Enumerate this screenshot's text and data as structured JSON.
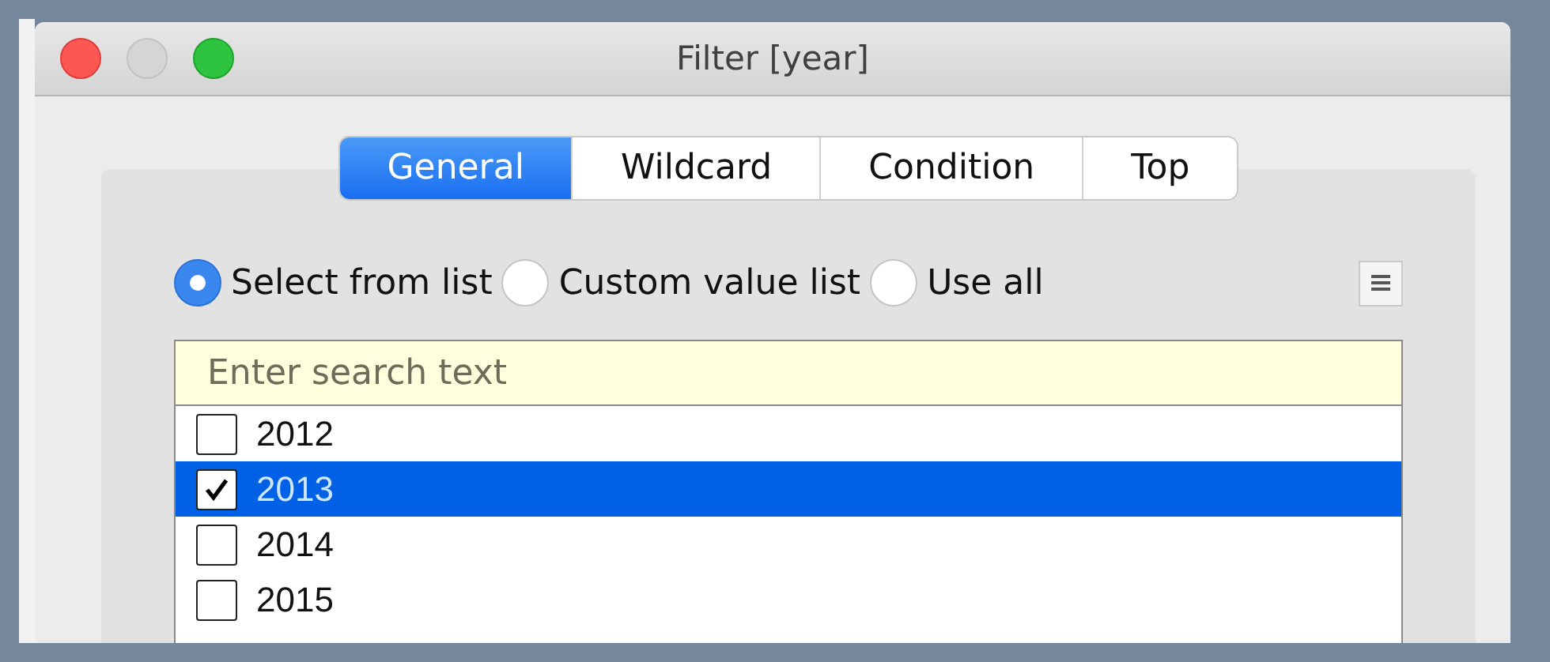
{
  "window": {
    "title": "Filter [year]"
  },
  "tabs": [
    {
      "label": "General",
      "selected": true
    },
    {
      "label": "Wildcard",
      "selected": false
    },
    {
      "label": "Condition",
      "selected": false
    },
    {
      "label": "Top",
      "selected": false
    }
  ],
  "options": [
    {
      "label": "Select from list",
      "selected": true
    },
    {
      "label": "Custom value list",
      "selected": false
    },
    {
      "label": "Use all",
      "selected": false
    }
  ],
  "search": {
    "placeholder": "Enter search text"
  },
  "items": [
    {
      "label": "2012",
      "checked": false,
      "selected": false
    },
    {
      "label": "2013",
      "checked": true,
      "selected": true
    },
    {
      "label": "2014",
      "checked": false,
      "selected": false
    },
    {
      "label": "2015",
      "checked": false,
      "selected": false
    }
  ]
}
